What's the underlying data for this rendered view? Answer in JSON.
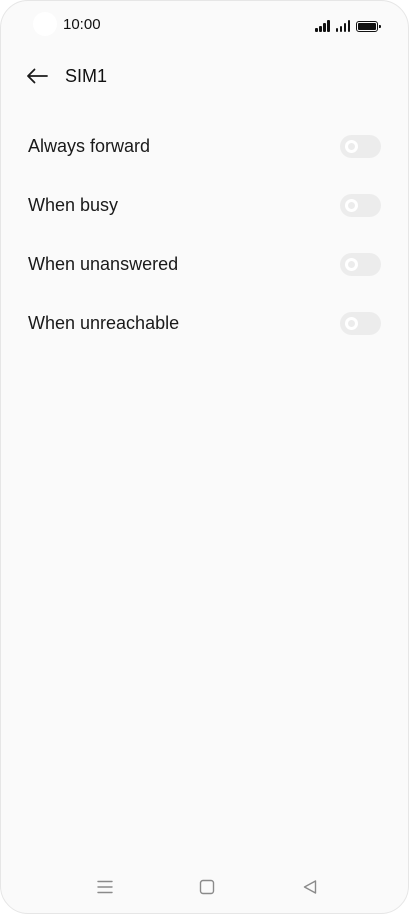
{
  "status_bar": {
    "time": "10:00"
  },
  "header": {
    "title": "SIM1"
  },
  "call_forwarding": {
    "items": [
      {
        "label": "Always forward",
        "enabled": false
      },
      {
        "label": "When busy",
        "enabled": false
      },
      {
        "label": "When unanswered",
        "enabled": false
      },
      {
        "label": "When unreachable",
        "enabled": false
      }
    ]
  },
  "colors": {
    "background": "#fafafa",
    "text": "#1a1a1a",
    "toggle_off_track": "#ececec",
    "toggle_knob": "#ffffff",
    "nav_icon": "#8a8a8a"
  },
  "icons": {
    "back": "back-arrow-icon",
    "recents": "menu-icon",
    "home": "home-square-icon",
    "back_nav": "triangle-back-icon"
  }
}
